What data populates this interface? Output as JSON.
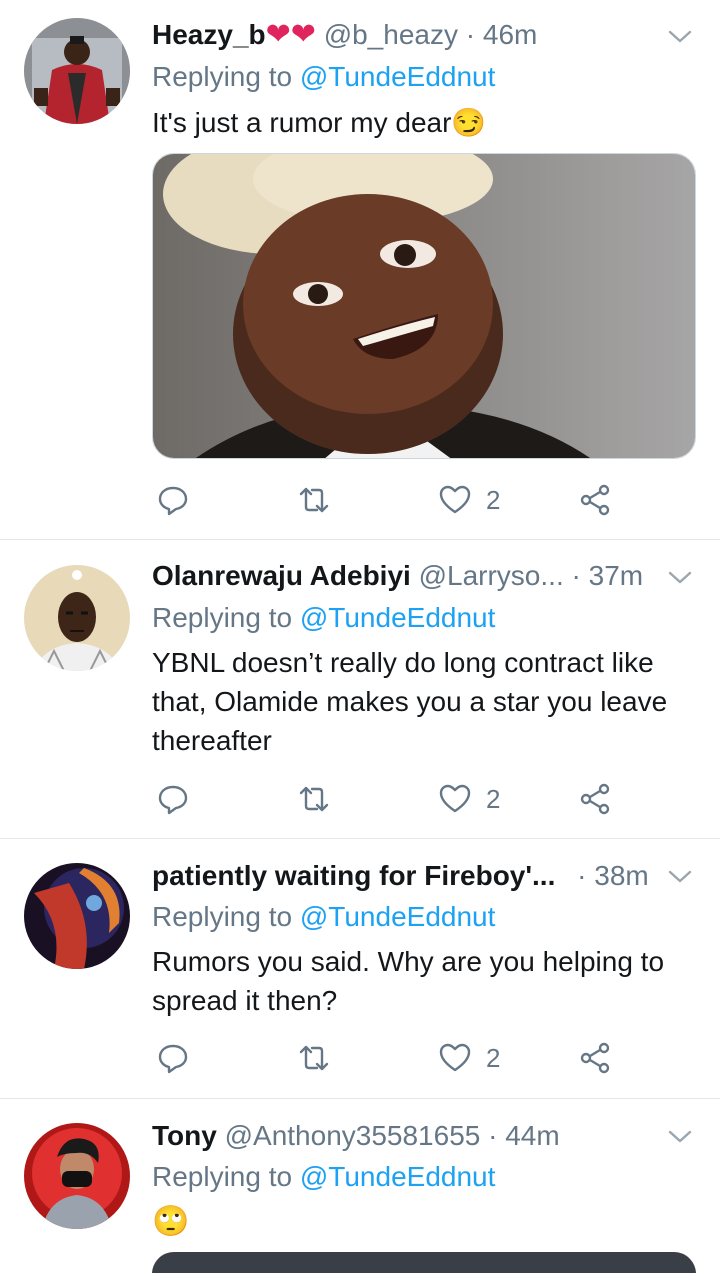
{
  "tweets": [
    {
      "name": "Heazy_b",
      "name_emoji": "❤❤",
      "handle": "@b_heazy",
      "time": "· 46m",
      "replying_prefix": "Replying to",
      "replying_to": "@TundeEddnut",
      "text": "It's just a rumor my dear😏",
      "likes": "2"
    },
    {
      "name": "Olanrewaju Adebiyi",
      "handle": "@Larryso...",
      "time": "· 37m",
      "replying_prefix": "Replying to",
      "replying_to": "@TundeEddnut",
      "text": "YBNL doesn’t really do long contract like that, Olamide makes you a star you leave thereafter",
      "likes": "2"
    },
    {
      "name": "patiently waiting for Fireboy'...",
      "handle": "",
      "time": "· 38m",
      "replying_prefix": "Replying to",
      "replying_to": "@TundeEddnut",
      "text": "Rumors you said. Why are you helping to spread it then?",
      "likes": "2"
    },
    {
      "name": "Tony",
      "handle": "@Anthony35581655",
      "time": "· 44m",
      "replying_prefix": "Replying to",
      "replying_to": "@TundeEddnut",
      "text": "🙄"
    }
  ],
  "icons": {
    "reply": "reply-icon",
    "retweet": "retweet-icon",
    "like": "heart-icon",
    "share": "share-icon",
    "more": "chevron-down-icon"
  },
  "colors": {
    "link": "#1da1f2",
    "secondary_text": "#657786",
    "heart_red": "#e0245e",
    "divider": "#e1e8ed"
  }
}
